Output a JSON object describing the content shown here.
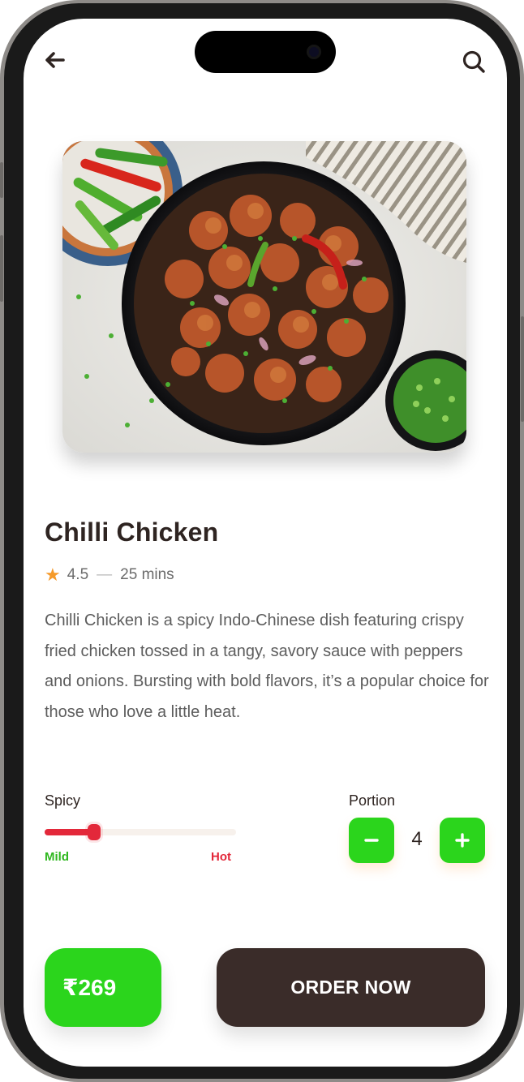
{
  "header": {
    "back_icon": "arrow-left-icon",
    "search_icon": "search-icon"
  },
  "dish": {
    "image_alt": "Chilli Chicken",
    "name": "Chilli Chicken",
    "rating": "4.5",
    "time": "25 mins",
    "description": "Chilli Chicken is a spicy Indo-Chinese dish featuring crispy fried chicken tossed in a tangy, savory sauce with peppers and onions. Bursting with bold flavors, it’s a popular choice for those who love a little heat."
  },
  "spicy": {
    "label": "Spicy",
    "level": 0.25,
    "min_label": "Mild",
    "max_label": "Hot"
  },
  "portion": {
    "label": "Portion",
    "value": "4",
    "minus_icon": "minus-icon",
    "plus_icon": "plus-icon"
  },
  "footer": {
    "price": "₹269",
    "order_label": "ORDER NOW"
  },
  "colors": {
    "primary_green": "#2bd51c",
    "dark_brown": "#3a2c29",
    "hot_red": "#e3283a",
    "star_orange": "#f59a2a"
  }
}
